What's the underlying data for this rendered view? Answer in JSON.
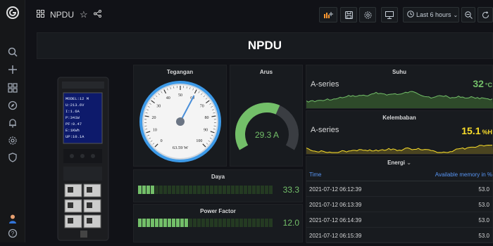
{
  "topbar": {
    "dashboard_name": "NPDU",
    "time_range": "Last 6 hours"
  },
  "title": "NPDU",
  "device": {
    "screen_lines": [
      "MODEL:12 M",
      "U:213.6V",
      "I:1.6A",
      "P:341W",
      "PF:0.47",
      "E:1KWh",
      "UP:10.1A"
    ]
  },
  "tegangan": {
    "title": "Tegangan",
    "value": 0.603,
    "value_text": "63.59 W",
    "ticks": [
      "0",
      "10",
      "20",
      "30",
      "40",
      "50",
      "60",
      "70",
      "80",
      "90",
      "100"
    ]
  },
  "arus": {
    "title": "Arus",
    "value_text": "29.3 A",
    "fraction": 0.6,
    "color": "#73bf69"
  },
  "suhu": {
    "title": "Suhu",
    "series": "A-series",
    "value": "32",
    "unit": "°C",
    "color": "#73bf69"
  },
  "kelembaban": {
    "title": "Kelembaban",
    "series": "A-series",
    "value": "15.1",
    "unit": "%H",
    "color": "#fade2a"
  },
  "daya": {
    "title": "Daya",
    "value_text": "33.3",
    "fraction": 0.11
  },
  "power_factor": {
    "title": "Power Factor",
    "value_text": "12.0",
    "fraction": 0.38
  },
  "energi": {
    "title": "Energi",
    "columns": [
      "Time",
      "Available memory in %"
    ],
    "rows": [
      [
        "2021-07-12 06:12:39",
        "53.0"
      ],
      [
        "2021-07-12 06:13:39",
        "53.0"
      ],
      [
        "2021-07-12 06:14:39",
        "53.0"
      ],
      [
        "2021-07-12 06:15:39",
        "53.0"
      ]
    ]
  }
}
